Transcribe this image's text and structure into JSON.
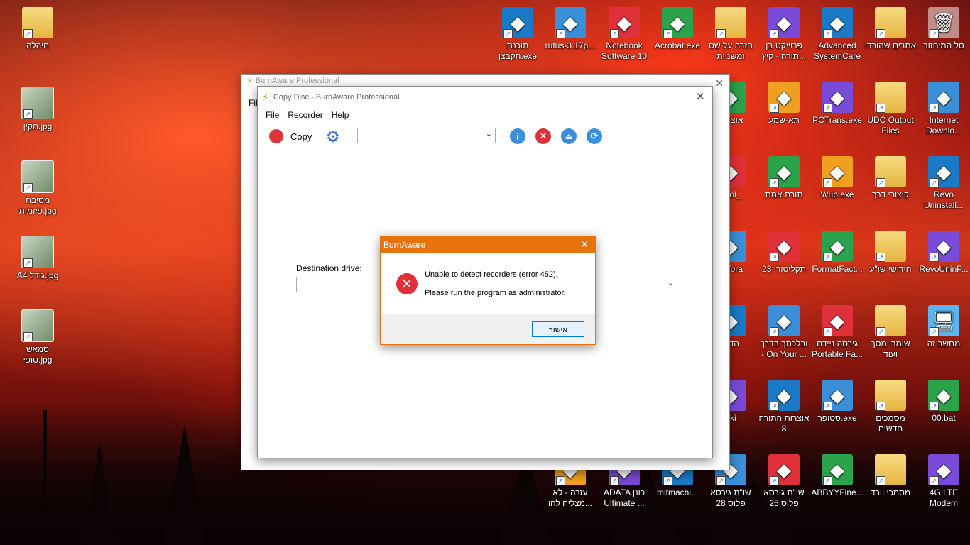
{
  "desktop": {
    "icons": [
      {
        "label": "חיהלה",
        "type": "folder"
      },
      {
        "label": "תקין.jpg",
        "type": "photo"
      },
      {
        "label": "מסיבת פיזמות.jpg",
        "type": "photo"
      },
      {
        "label": "A4 גודל.jpg",
        "type": "photo"
      },
      {
        "label": "סמאש סופי.jpg",
        "type": "photo"
      },
      {
        "label": "תוכנת הקבצן.exe",
        "type": "app"
      },
      {
        "label": "rufus-3.17p...",
        "type": "app"
      },
      {
        "label": "Notebook Software 10",
        "type": "app"
      },
      {
        "label": "Acrobat.exe",
        "type": "app"
      },
      {
        "label": "חזרה על שס ומשניות",
        "type": "folder"
      },
      {
        "label": "פרוייקט בן תורה - קיץ...",
        "type": "app"
      },
      {
        "label": "Advanced SystemCare",
        "type": "app"
      },
      {
        "label": "אתרים שהורדו",
        "type": "folder"
      },
      {
        "label": "סל המיחזור",
        "type": "bin"
      },
      {
        "label": "אוצר ה",
        "type": "app"
      },
      {
        "label": "תא-שמע",
        "type": "app"
      },
      {
        "label": "PCTrans.exe",
        "type": "app"
      },
      {
        "label": "UDC Output Files",
        "type": "folder"
      },
      {
        "label": "Internet Downlo...",
        "type": "app"
      },
      {
        "label": "thlol_",
        "type": "app"
      },
      {
        "label": "תורת אמת",
        "type": "app"
      },
      {
        "label": "Wub.exe",
        "type": "app"
      },
      {
        "label": "קיצורי דרך",
        "type": "folder"
      },
      {
        "label": "Revo Uninstall...",
        "type": "app"
      },
      {
        "label": "orTora",
        "type": "app"
      },
      {
        "label": "23 תקליטורי",
        "type": "app"
      },
      {
        "label": "FormatFact...",
        "type": "app"
      },
      {
        "label": "חידושי שו\"ע",
        "type": "folder"
      },
      {
        "label": "RevoUninP...",
        "type": "app"
      },
      {
        "label": "הדרן",
        "type": "app"
      },
      {
        "label": "ובלכתך בדרך - On Your ...",
        "type": "app"
      },
      {
        "label": "גירסה ניידת Portable Fa...",
        "type": "app"
      },
      {
        "label": "שומרי מסך ועוד",
        "type": "folder"
      },
      {
        "label": "מחשב זה",
        "type": "pc"
      },
      {
        "label": "nki",
        "type": "app"
      },
      {
        "label": "אוצרות התורה 8",
        "type": "app"
      },
      {
        "label": "סטופר.exe",
        "type": "app"
      },
      {
        "label": "מסמכים חדשים",
        "type": "folder"
      },
      {
        "label": "00.bat",
        "type": "app"
      },
      {
        "label": "עזרה - לא מצליח להו...",
        "type": "app"
      },
      {
        "label": "ADATA כונן Ultimate ...",
        "type": "app"
      },
      {
        "label": "mitmachi...",
        "type": "app"
      },
      {
        "label": "שו\"ת גירסא פלוס 28",
        "type": "app"
      },
      {
        "label": "שו\"ת גירסא פלוס 25",
        "type": "app"
      },
      {
        "label": "ABBYYFine...",
        "type": "app"
      },
      {
        "label": "מסמכי וורד",
        "type": "folder"
      },
      {
        "label": "4G LTE Modem",
        "type": "app"
      }
    ]
  },
  "back_window": {
    "title": "BurnAware Professional",
    "menu_fragment": "Fil"
  },
  "copy_window": {
    "title": "Copy Disc - BurnAware Professional",
    "menu": [
      "File",
      "Recorder",
      "Help"
    ],
    "copy_label": "Copy",
    "dest_label": "Destination drive:",
    "colors": {
      "info": "#3a8fd8",
      "stop": "#e0303a",
      "eject": "#3a8fd8",
      "refresh": "#3a8fd8",
      "record": "#e0363a"
    }
  },
  "dialog": {
    "title": "BurnAware",
    "line1": "Unable to detect recorders (error 452).",
    "line2": "Please run the program as administrator.",
    "ok_label": "אישור",
    "title_color": "#e8720c"
  }
}
